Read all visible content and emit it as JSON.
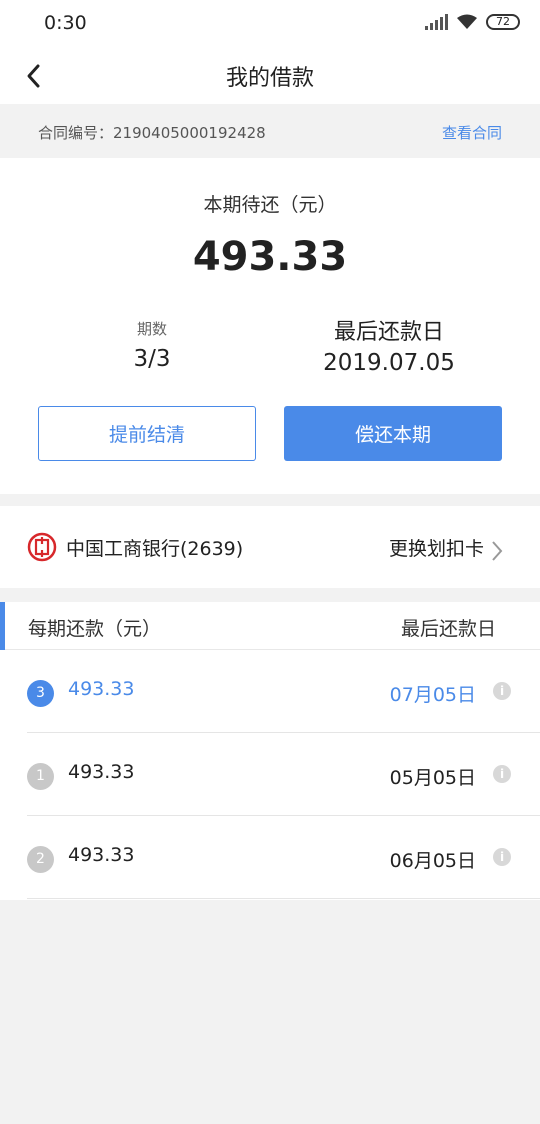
{
  "status_bar": {
    "time": "0:30",
    "battery": "72"
  },
  "nav": {
    "title": "我的借款",
    "back_icon": "chevron-left-icon"
  },
  "contract": {
    "label": "合同编号：2190405000192428",
    "link": "查看合同"
  },
  "summary": {
    "due_label": "本期待还（元）",
    "due_amount": "493.33",
    "period_label": "期数",
    "period_value": "3/3",
    "last_day_label": "最后还款日",
    "last_day_value": "2019.07.05",
    "early_button": "提前结清",
    "repay_button": "偿还本期"
  },
  "bank": {
    "name": "中国工商银行(2639)",
    "change_label": "更换划扣卡",
    "logo_icon": "icbc-logo-icon"
  },
  "schedule": {
    "header_left": "每期还款（元）",
    "header_right": "最后还款日",
    "rows": [
      {
        "num": "3",
        "amount": "493.33",
        "date": "07月05日",
        "active": true
      },
      {
        "num": "1",
        "amount": "493.33",
        "date": "05月05日",
        "active": false
      },
      {
        "num": "2",
        "amount": "493.33",
        "date": "06月05日",
        "active": false
      }
    ]
  },
  "colors": {
    "accent": "#4a8ae8",
    "bank_red": "#d7282b",
    "muted_badge": "#c8c8c8"
  }
}
